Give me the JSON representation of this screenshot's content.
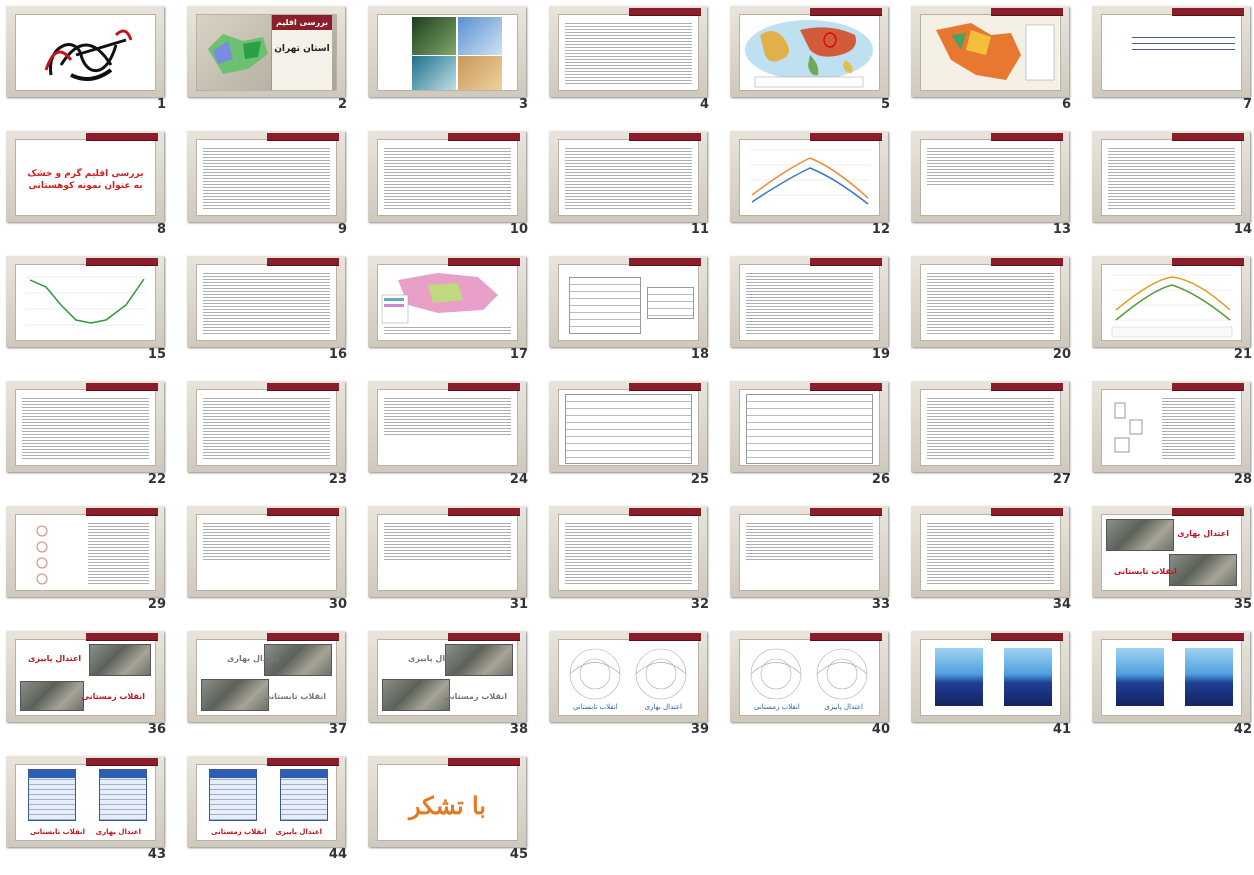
{
  "slides": [
    {
      "num": "1",
      "kind": "calligraphy"
    },
    {
      "num": "2",
      "kind": "title",
      "title": "بررسی اقلیم",
      "subtitle": "استان تهران"
    },
    {
      "num": "3",
      "kind": "nature"
    },
    {
      "num": "4",
      "kind": "text"
    },
    {
      "num": "5",
      "kind": "worldmap"
    },
    {
      "num": "6",
      "kind": "iranmap"
    },
    {
      "num": "7",
      "kind": "list"
    },
    {
      "num": "8",
      "kind": "redtitle",
      "title": "بررسی اقلیم گرم و خشک به عنوان نمونه کوهستانی"
    },
    {
      "num": "9",
      "kind": "text"
    },
    {
      "num": "10",
      "kind": "text"
    },
    {
      "num": "11",
      "kind": "text"
    },
    {
      "num": "12",
      "kind": "chart"
    },
    {
      "num": "13",
      "kind": "textshort"
    },
    {
      "num": "14",
      "kind": "text"
    },
    {
      "num": "15",
      "kind": "chart2"
    },
    {
      "num": "16",
      "kind": "text"
    },
    {
      "num": "17",
      "kind": "map2"
    },
    {
      "num": "18",
      "kind": "table"
    },
    {
      "num": "19",
      "kind": "text"
    },
    {
      "num": "20",
      "kind": "text"
    },
    {
      "num": "21",
      "kind": "chart3"
    },
    {
      "num": "22",
      "kind": "text"
    },
    {
      "num": "23",
      "kind": "text"
    },
    {
      "num": "24",
      "kind": "textshort"
    },
    {
      "num": "25",
      "kind": "table2"
    },
    {
      "num": "26",
      "kind": "table2"
    },
    {
      "num": "27",
      "kind": "text"
    },
    {
      "num": "28",
      "kind": "diagram"
    },
    {
      "num": "29",
      "kind": "diagram2"
    },
    {
      "num": "30",
      "kind": "textshort"
    },
    {
      "num": "31",
      "kind": "textshort"
    },
    {
      "num": "32",
      "kind": "text"
    },
    {
      "num": "33",
      "kind": "textshort"
    },
    {
      "num": "34",
      "kind": "text"
    },
    {
      "num": "35",
      "kind": "aerial",
      "a": "اعتدال بهاری",
      "b": "انقلاب تابستانی"
    },
    {
      "num": "36",
      "kind": "aerial2",
      "a": "اعتدال پاییزی",
      "b": "انقلاب زمستانی"
    },
    {
      "num": "37",
      "kind": "aerial3",
      "a": "اعتدال بهاری",
      "b": "انقلاب تابستانی"
    },
    {
      "num": "38",
      "kind": "aerial3",
      "a": "اعتدال پاییزی",
      "b": "انقلاب زمستانی"
    },
    {
      "num": "39",
      "kind": "sun",
      "a": "انقلاب تابستانی",
      "b": "اعتدال بهاری"
    },
    {
      "num": "40",
      "kind": "sun",
      "a": "انقلاب زمستانی",
      "b": "اعتدال پاییزی"
    },
    {
      "num": "41",
      "kind": "blue"
    },
    {
      "num": "42",
      "kind": "blue"
    },
    {
      "num": "43",
      "kind": "bluetable",
      "a": "انقلاب تابستانی",
      "b": "اعتدال بهاری"
    },
    {
      "num": "44",
      "kind": "bluetable",
      "a": "انقلاب زمستانی",
      "b": "اعتدال پاییزی"
    },
    {
      "num": "45",
      "kind": "thanks",
      "title": "با تشکر"
    }
  ]
}
